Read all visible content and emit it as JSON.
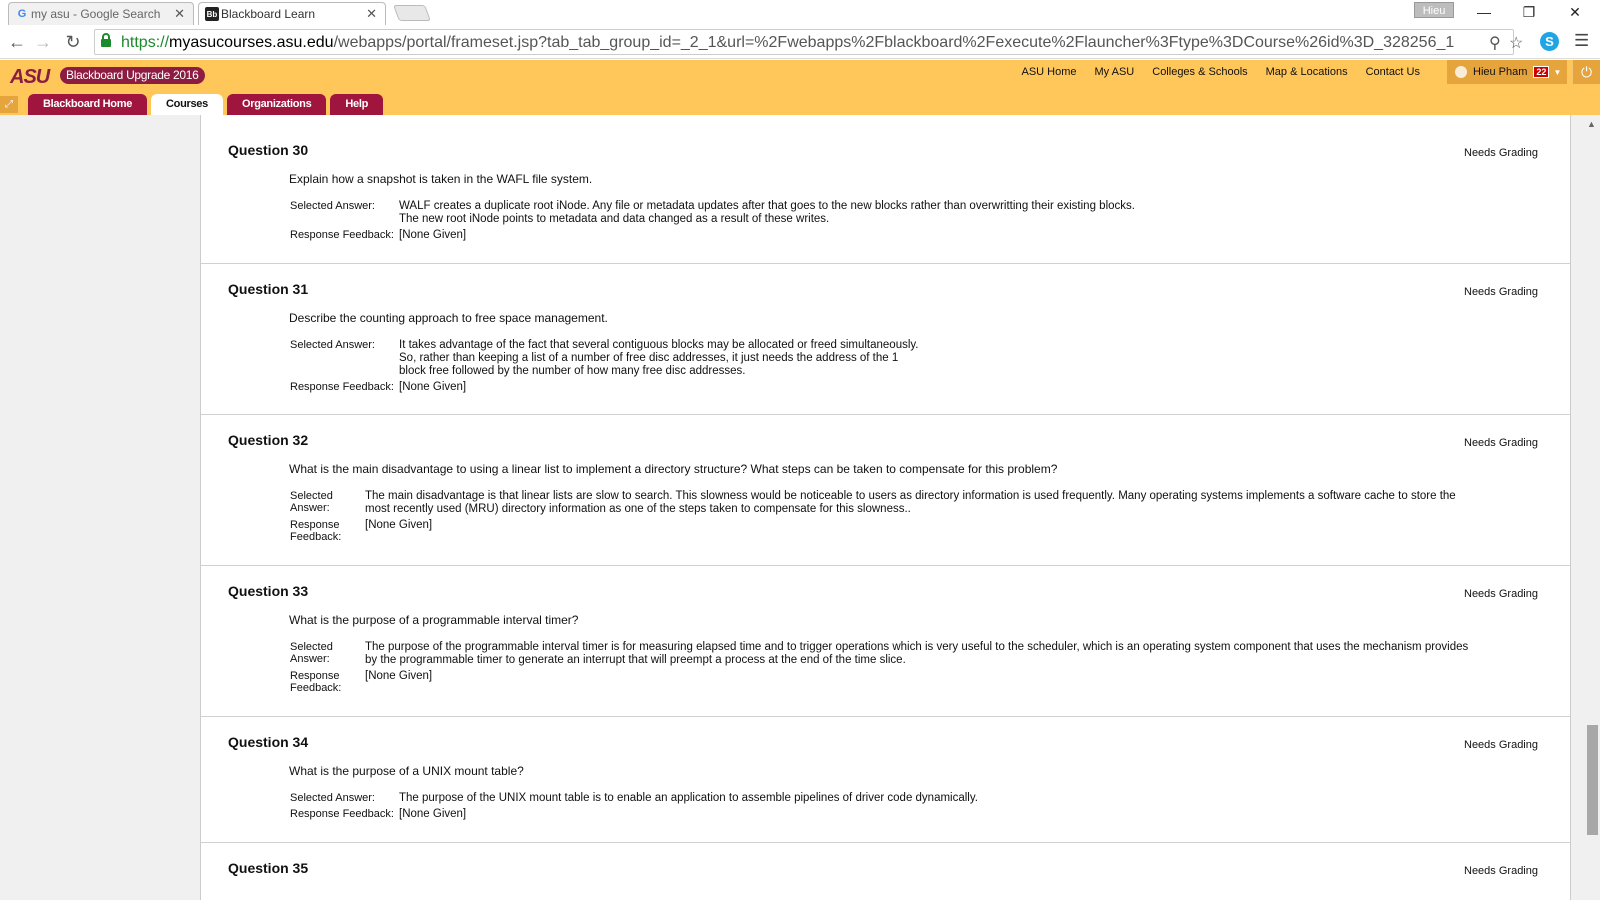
{
  "browser": {
    "tabs": [
      {
        "title": "my asu - Google Search",
        "favicon": "G"
      },
      {
        "title": "Blackboard Learn",
        "favicon": "Bb"
      }
    ],
    "profile_name": "Hieu",
    "url": {
      "scheme": "https://",
      "host": "myasucourses.asu.edu",
      "path": "/webapps/portal/frameset.jsp?tab_tab_group_id=_2_1&url=%2Fwebapps%2Fblackboard%2Fexecute%2Flauncher%3Ftype%3DCourse%26id%3D_328256_1"
    }
  },
  "header": {
    "logo": "ASU",
    "upgrade_badge": "Blackboard Upgrade 2016",
    "links": [
      "ASU Home",
      "My ASU",
      "Colleges & Schools",
      "Map & Locations",
      "Contact Us"
    ],
    "user": {
      "name": "Hieu Pham",
      "notifications": "22"
    },
    "nav_tabs": [
      "Blackboard Home",
      "Courses",
      "Organizations",
      "Help"
    ],
    "active_tab": "Courses"
  },
  "questions": [
    {
      "title": "Question 30",
      "status": "Needs Grading",
      "text": "Explain how a snapshot is taken in the WAFL file system.",
      "answer_label": "Selected Answer:",
      "answer_lines": [
        "WALF creates a duplicate root iNode. Any file or metadata updates after that goes to the new blocks rather than overwritting their existing blocks.",
        "The new root iNode points to metadata and data changed as a result of these writes."
      ],
      "feedback_label": "Response Feedback:",
      "feedback": "[None Given]"
    },
    {
      "title": "Question 31",
      "status": "Needs Grading",
      "text": "Describe the counting approach to free space management.",
      "answer_label": "Selected Answer:",
      "answer_lines": [
        "It takes advantage of the fact that several contiguous blocks may be allocated or freed simultaneously.",
        "So, rather than keeping a list of a number of free disc addresses, it just needs the address of  the 1",
        "block free followed by the number of how many free disc addresses."
      ],
      "feedback_label": "Response Feedback:",
      "feedback": "[None Given]"
    },
    {
      "title": "Question 32",
      "status": "Needs Grading",
      "text": "What is the main disadvantage to using a linear list to implement a directory structure? What steps can be taken to compensate for this problem?",
      "answer_label_lines": [
        "Selected",
        "Answer:"
      ],
      "answer_lines": [
        "The main disadvantage is that linear lists are slow to search. This slowness would be noticeable to users as directory information is used frequently. Many operating systems implements a software cache to store the",
        "most recently used (MRU) directory information as one of the steps taken to compensate for this slowness.."
      ],
      "feedback_label_lines": [
        "Response",
        "Feedback:"
      ],
      "feedback": "[None Given]"
    },
    {
      "title": "Question 33",
      "status": "Needs Grading",
      "text": "What is the purpose of a programmable interval timer?",
      "answer_label_lines": [
        "Selected",
        "Answer:"
      ],
      "answer_lines": [
        "The purpose of the programmable interval timer is for measuring elapsed time and to trigger operations which is very useful to the scheduler, which is an operating system component that uses the mechanism provides",
        "by the programmable timer to generate an interrupt that will preempt a process at the end of the time slice."
      ],
      "feedback_label_lines": [
        "Response",
        "Feedback:"
      ],
      "feedback": "[None Given]"
    },
    {
      "title": "Question 34",
      "status": "Needs Grading",
      "text": "What is the purpose of a UNIX mount table?",
      "answer_label": "Selected Answer:",
      "answer_lines": [
        "The purpose of the UNIX mount table is to enable an application to assemble pipelines of driver code dynamically."
      ],
      "feedback_label": "Response Feedback:",
      "feedback": "[None Given]"
    },
    {
      "title": "Question 35",
      "status": "Needs Grading"
    }
  ],
  "colors": {
    "asu_maroon": "#8c1d40",
    "asu_gold": "#ffc75a",
    "tab_maroon": "#a0153e"
  }
}
